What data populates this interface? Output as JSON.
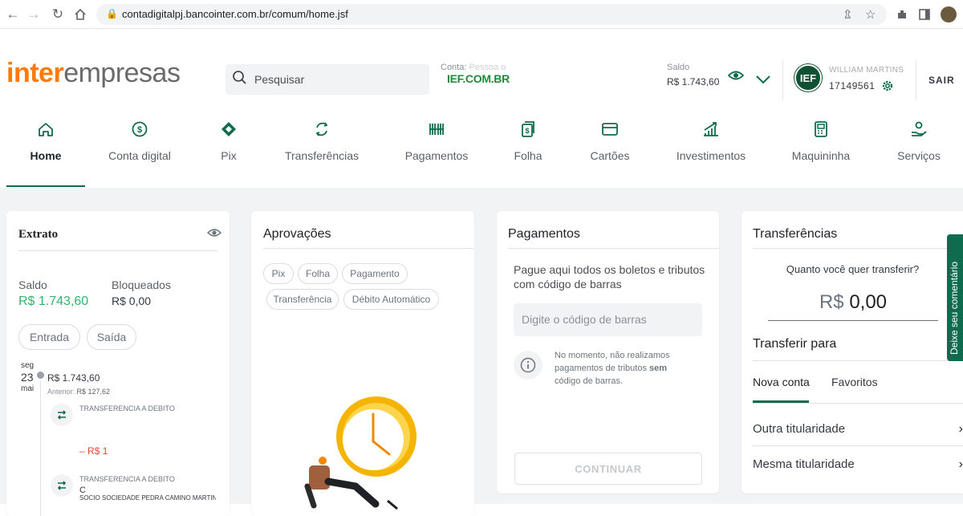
{
  "browser": {
    "url": "contadigitalpj.bancointer.com.br/comum/home.jsf"
  },
  "header": {
    "logo_brand": "inter",
    "logo_suffix": "empresas",
    "search_placeholder": "Pesquisar",
    "conta_label": "Conta:",
    "conta_label_overlay": "Pessoa o",
    "conta_name": "IEF.COM.BR",
    "saldo_label": "Saldo",
    "saldo_value": "R$ 1.743,60",
    "avatar_initials": "IEF",
    "user_name": "WILLIAM MARTINS",
    "user_account": "17149561",
    "logout": "SAIR"
  },
  "nav": [
    {
      "label": "Home",
      "icon": "home-icon",
      "active": true
    },
    {
      "label": "Conta digital",
      "icon": "dollar-coin-icon"
    },
    {
      "label": "Pix",
      "icon": "pix-icon"
    },
    {
      "label": "Transferências",
      "icon": "transfer-icon"
    },
    {
      "label": "Pagamentos",
      "icon": "barcode-icon"
    },
    {
      "label": "Folha",
      "icon": "payroll-icon"
    },
    {
      "label": "Cartões",
      "icon": "card-icon"
    },
    {
      "label": "Investimentos",
      "icon": "chart-up-icon"
    },
    {
      "label": "Maquininha",
      "icon": "pos-terminal-icon"
    },
    {
      "label": "Serviços",
      "icon": "services-icon"
    }
  ],
  "extrato": {
    "title": "Extrato",
    "saldo_label": "Saldo",
    "saldo_value": "R$ 1.743,60",
    "bloqueados_label": "Bloqueados",
    "bloqueados_value": "R$ 0,00",
    "btn_entrada": "Entrada",
    "btn_saida": "Saída",
    "day_name": "seg",
    "day_num": "23",
    "month": "mai",
    "day_balance": "R$ 1.743,60",
    "anterior_label": "Anterior:",
    "anterior_value": "R$ 127,62",
    "tx1_title": "TRANSFERENCIA A DEBITO",
    "tx1_amount": "R$ 1",
    "tx1_sign": "–",
    "tx2_title": "TRANSFERENCIA A DEBITO",
    "tx2_line2": "C",
    "tx2_line3": "SOCIO SOCIEDADE PEDRA CAMINO MARTINS"
  },
  "aprovacoes": {
    "title": "Aprovações",
    "chips": [
      "Pix",
      "Folha",
      "Pagamento",
      "Transferência",
      "Débito Automático"
    ]
  },
  "pagamentos": {
    "title": "Pagamentos",
    "intro": "Pague aqui todos os boletos e tributos com código de barras",
    "input_placeholder": "Digite o código de barras",
    "notice_part1": "No momento, não realizamos pagamentos de tributos ",
    "notice_bold": "sem",
    "notice_part2": "código de barras.",
    "button": "CONTINUAR"
  },
  "transferencias": {
    "title": "Transferências",
    "question": "Quanto você quer transferir?",
    "currency": "R$",
    "amount": "0,00",
    "transfer_to": "Transferir para",
    "tabs": [
      "Nova conta",
      "Favoritos"
    ],
    "options": [
      "Outra titularidade",
      "Mesma titularidade"
    ]
  },
  "feedback": {
    "label": "Deixe seu comentário"
  },
  "colors": {
    "brand_orange": "#ff7a00",
    "brand_green": "#0f6b4e",
    "balance_green": "#35b26b",
    "negative_red": "#e8453c"
  }
}
